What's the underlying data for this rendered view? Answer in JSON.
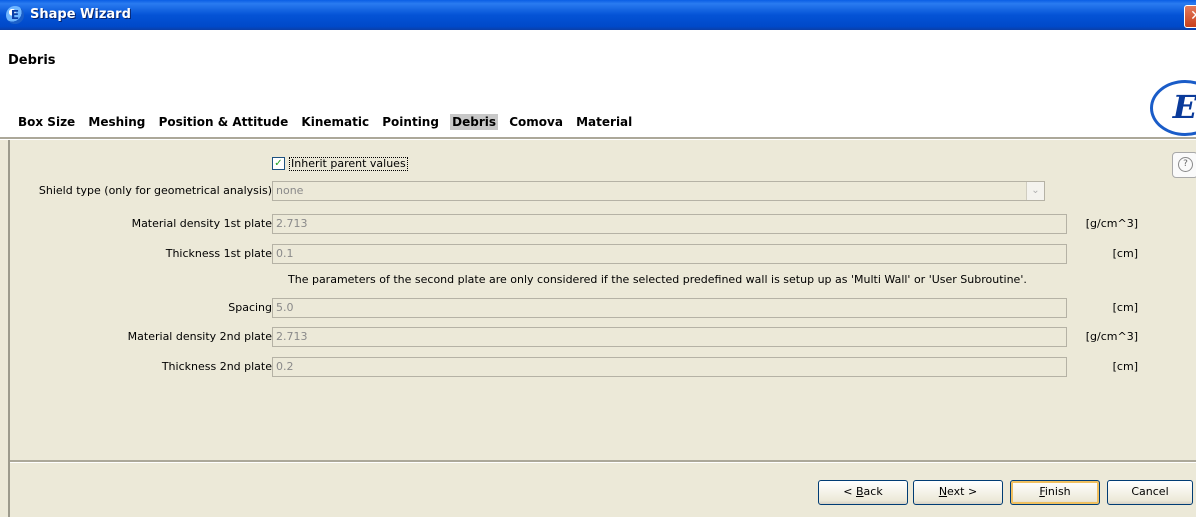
{
  "window": {
    "title": "Shape Wizard",
    "close_glyph": "✕",
    "app_icon": "E"
  },
  "header": {
    "step_title": "Debris",
    "logo_text": "E"
  },
  "tabs": [
    {
      "label": "Box Size",
      "active": false
    },
    {
      "label": "Meshing",
      "active": false
    },
    {
      "label": "Position & Attitude",
      "active": false
    },
    {
      "label": "Kinematic",
      "active": false
    },
    {
      "label": "Pointing",
      "active": false
    },
    {
      "label": "Debris",
      "active": true
    },
    {
      "label": "Comova",
      "active": false
    },
    {
      "label": "Material",
      "active": false
    }
  ],
  "form": {
    "inherit": {
      "label": "Inherit parent values",
      "checked": true,
      "check_glyph": "✓"
    },
    "shield_type": {
      "label": "Shield type (only for geometrical analysis)",
      "value": "none",
      "dropdown_glyph": "⌄"
    },
    "density1": {
      "label": "Material density 1st plate",
      "value": "2.713",
      "unit": "[g/cm^3]"
    },
    "thickness1": {
      "label": "Thickness 1st plate",
      "value": "0.1",
      "unit": "[cm]"
    },
    "note": "The parameters of the second plate are only considered if the selected predefined wall is setup up as 'Multi Wall' or 'User Subroutine'.",
    "spacing": {
      "label": "Spacing",
      "value": "5.0",
      "unit": "[cm]"
    },
    "density2": {
      "label": "Material density 2nd plate",
      "value": "2.713",
      "unit": "[g/cm^3]"
    },
    "thickness2": {
      "label": "Thickness 2nd plate",
      "value": "0.2",
      "unit": "[cm]"
    }
  },
  "help_glyph": "?",
  "buttons": {
    "back": {
      "pre": "< ",
      "mnemonic": "B",
      "post": "ack"
    },
    "next": {
      "pre": "",
      "mnemonic": "N",
      "post": "ext >"
    },
    "finish": {
      "pre": "",
      "mnemonic": "F",
      "post": "inish"
    },
    "cancel": {
      "label": "Cancel"
    }
  },
  "icons": {
    "app": "app-icon",
    "close": "close-icon",
    "help": "help-icon",
    "dropdown": "chevron-down-icon",
    "logo": "logo-icon"
  }
}
